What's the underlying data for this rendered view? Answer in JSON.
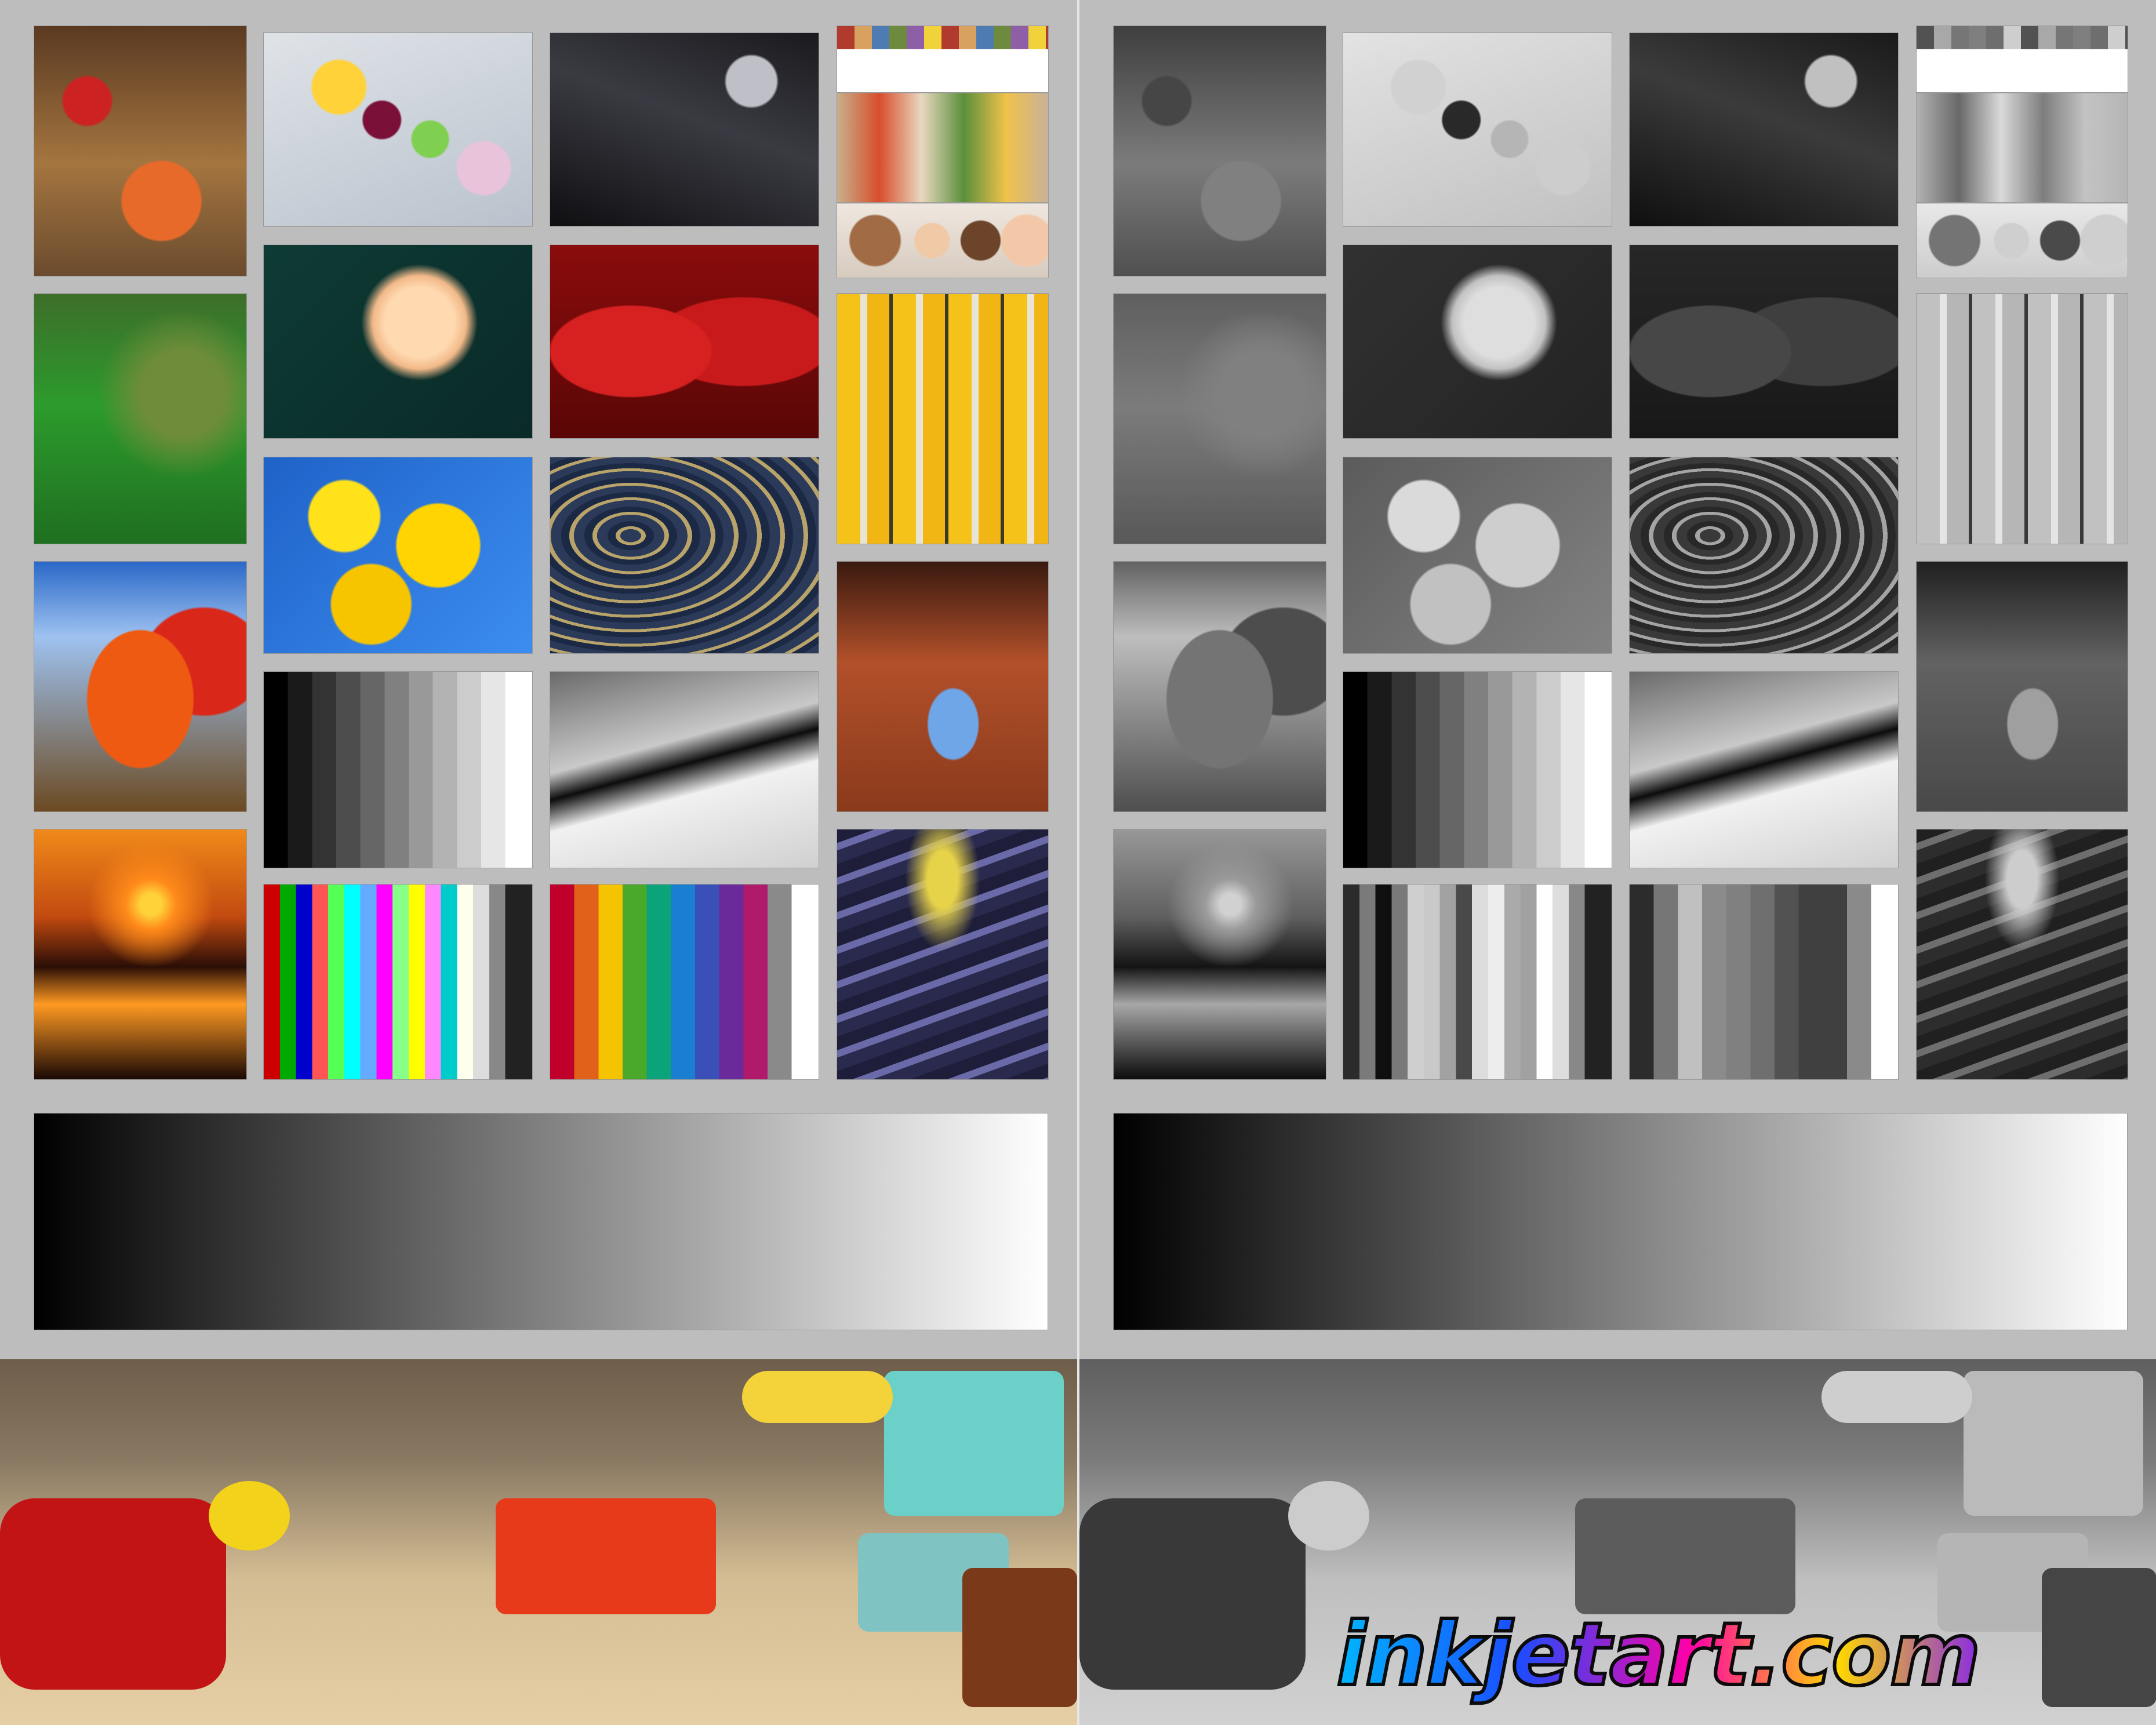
{
  "brand": {
    "logo_text": "inkjetart.com",
    "logo_colors": [
      "#00b6ff",
      "#1a4dff",
      "#ff00a8",
      "#ffd800",
      "#8a2be2"
    ]
  },
  "layout": {
    "halves": [
      "color",
      "grayscale"
    ]
  }
}
